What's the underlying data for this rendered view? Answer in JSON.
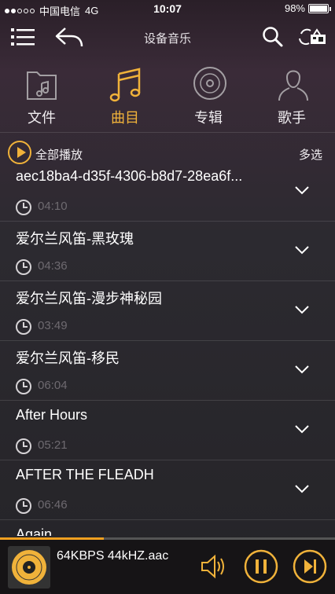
{
  "status_bar": {
    "carrier": "中国电信",
    "network": "4G",
    "time": "10:07",
    "battery": "98%",
    "battery_level": 0.98
  },
  "nav": {
    "title": "设备音乐"
  },
  "categories": [
    {
      "label": "文件",
      "icon": "folder-music-icon"
    },
    {
      "label": "曲目",
      "icon": "music-note-icon"
    },
    {
      "label": "专辑",
      "icon": "disc-icon"
    },
    {
      "label": "歌手",
      "icon": "person-icon"
    }
  ],
  "active_category": "曲目",
  "toolbar": {
    "play_all": "全部播放",
    "multi_select": "多选"
  },
  "songs": [
    {
      "title": "aec18ba4-d35f-4306-b8d7-28ea6f...",
      "duration": "04:10"
    },
    {
      "title": "爱尔兰风笛-黑玫瑰",
      "duration": "04:36"
    },
    {
      "title": "爱尔兰风笛-漫步神秘园",
      "duration": "03:49"
    },
    {
      "title": "爱尔兰风笛-移民",
      "duration": "06:04"
    },
    {
      "title": "After Hours",
      "duration": "05:21"
    },
    {
      "title": "AFTER THE FLEADH",
      "duration": "06:46"
    },
    {
      "title": "Again",
      "duration": ""
    }
  ],
  "player": {
    "now_playing": "64KBPS 44kHZ.aac",
    "progress": 0.31
  },
  "colors": {
    "accent": "#f0b23a"
  }
}
